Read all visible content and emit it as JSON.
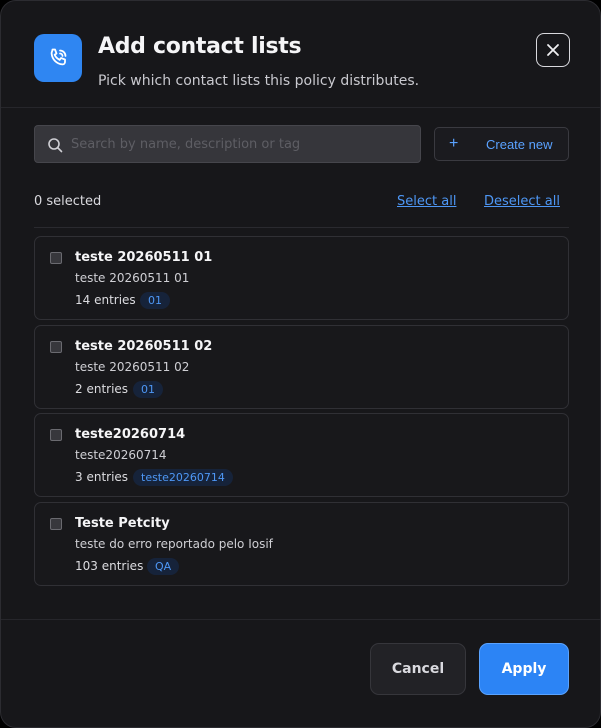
{
  "header": {
    "icon": "phone-call-icon",
    "title": "Add contact lists",
    "subtitle": "Pick which contact lists this policy distributes.",
    "close_icon": "close-icon"
  },
  "search": {
    "placeholder": "Search by name, description or tag",
    "value": "",
    "icon": "search-icon"
  },
  "create": {
    "icon": "plus-icon",
    "label": "Create new"
  },
  "selection": {
    "count_label": "0 selected",
    "select_all": "Select all",
    "deselect_all": "Deselect all"
  },
  "lists": [
    {
      "name": "teste 20260511 01",
      "description": "teste 20260511 01",
      "entries": "14 entries",
      "tag": "01",
      "checked": false
    },
    {
      "name": "teste 20260511 02",
      "description": "teste 20260511 02",
      "entries": "2 entries",
      "tag": "01",
      "checked": false
    },
    {
      "name": "teste20260714",
      "description": "teste20260714",
      "entries": "3 entries",
      "tag": "teste20260714",
      "checked": false
    },
    {
      "name": "Teste Petcity",
      "description": "teste do erro reportado pelo Iosif",
      "entries": "103 entries",
      "tag": "QA",
      "checked": false
    }
  ],
  "footer": {
    "cancel_label": "Cancel",
    "apply_label": "Apply"
  },
  "colors": {
    "accent": "#2c84f5",
    "link": "#4e97f5",
    "background": "#17171a"
  }
}
